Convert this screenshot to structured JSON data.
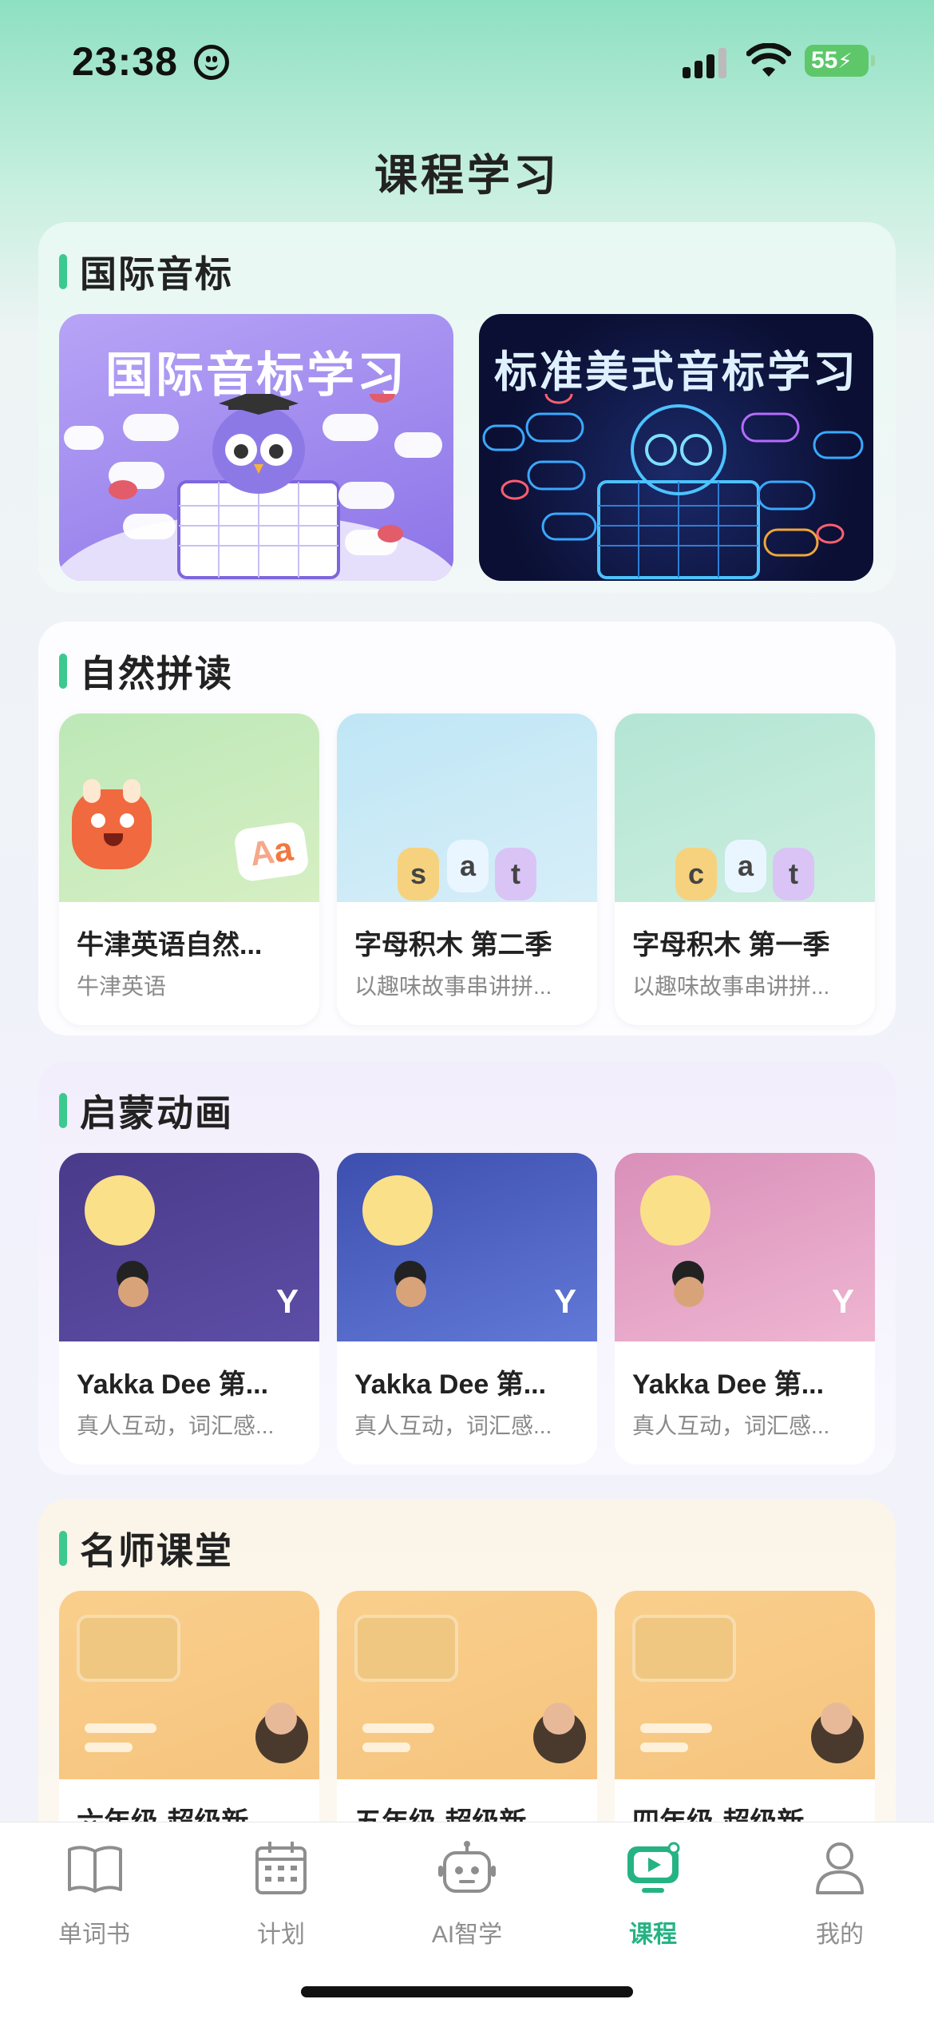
{
  "status_bar": {
    "time": "23:38",
    "battery": "55"
  },
  "page_title": "课程学习",
  "phonetics": {
    "title": "国际音标",
    "banners": [
      {
        "label": "国际音标学习"
      },
      {
        "label": "标准美式音标学习"
      }
    ]
  },
  "phonics": {
    "title": "自然拼读",
    "thumb_letters": {
      "first": "Aa",
      "second": [
        "s",
        "a",
        "t"
      ],
      "third": [
        "c",
        "a",
        "t"
      ]
    },
    "cards": [
      {
        "title": "牛津英语自然...",
        "subtitle": "牛津英语"
      },
      {
        "title": "字母积木 第二季",
        "subtitle": "以趣味故事串讲拼..."
      },
      {
        "title": "字母积木 第一季",
        "subtitle": "以趣味故事串讲拼..."
      }
    ]
  },
  "animation": {
    "title": "启蒙动画",
    "thumb_letter": "Y",
    "cards": [
      {
        "title": "Yakka Dee 第...",
        "subtitle": "真人互动，词汇感..."
      },
      {
        "title": "Yakka Dee 第...",
        "subtitle": "真人互动，词汇感..."
      },
      {
        "title": "Yakka Dee 第...",
        "subtitle": "真人互动，词汇感..."
      }
    ]
  },
  "teachers": {
    "title": "名师课堂",
    "cards": [
      {
        "title": "六年级-超级新"
      },
      {
        "title": "五年级-超级新"
      },
      {
        "title": "四年级-超级新"
      }
    ]
  },
  "tabbar": {
    "tabs": [
      {
        "label": "单词书",
        "icon": "book-icon"
      },
      {
        "label": "计划",
        "icon": "calendar-icon"
      },
      {
        "label": "AI智学",
        "icon": "robot-icon"
      },
      {
        "label": "课程",
        "icon": "course-play-icon",
        "active": true
      },
      {
        "label": "我的",
        "icon": "person-icon"
      }
    ]
  },
  "colors": {
    "accent": "#25b384",
    "section_bar": "#3cc98f"
  }
}
